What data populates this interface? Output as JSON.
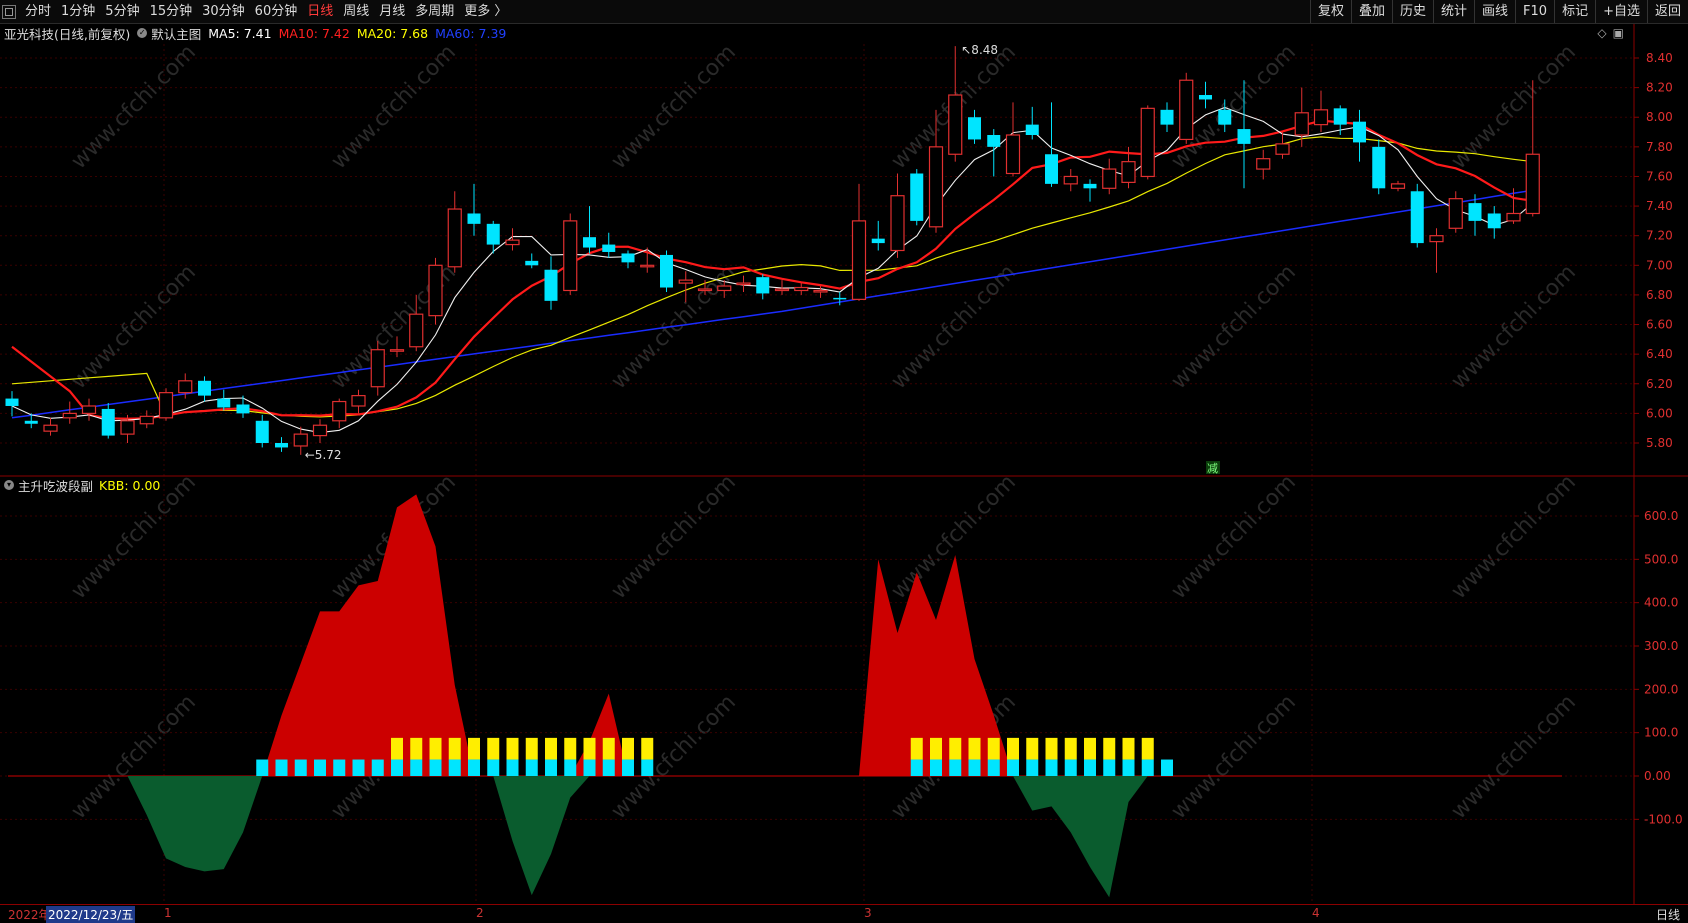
{
  "toolbar": {
    "left_items": [
      "分时",
      "1分钟",
      "5分钟",
      "15分钟",
      "30分钟",
      "60分钟",
      "日线",
      "周线",
      "月线",
      "多周期",
      "更多 〉"
    ],
    "active_item": "日线",
    "right_items": [
      "复权",
      "叠加",
      "历史",
      "统计",
      "画线",
      "F10",
      "标记",
      "+自选",
      "返回"
    ]
  },
  "main_chart": {
    "title": "亚光科技(日线,前复权)",
    "template": "默认主图",
    "ma": [
      {
        "label": "MA5: 7.41",
        "color": "#ffffff"
      },
      {
        "label": "MA10: 7.42",
        "color": "#ff2020"
      },
      {
        "label": "MA20: 7.68",
        "color": "#ffff00"
      },
      {
        "label": "MA60: 7.39",
        "color": "#2040ff"
      }
    ],
    "y_ticks": [
      "8.40",
      "8.20",
      "8.00",
      "7.80",
      "7.60",
      "7.40",
      "7.20",
      "7.00",
      "6.80",
      "6.60",
      "6.40",
      "6.20",
      "6.00",
      "5.80"
    ],
    "high_label": "8.48",
    "low_label": "5.72",
    "marker_text": "减",
    "candles": [
      [
        6.1,
        6.05,
        6.15,
        5.98
      ],
      [
        5.95,
        5.93,
        6.0,
        5.9
      ],
      [
        5.88,
        5.92,
        5.97,
        5.85
      ],
      [
        5.97,
        6.0,
        6.08,
        5.93
      ],
      [
        6.0,
        6.05,
        6.1,
        5.95
      ],
      [
        6.03,
        5.85,
        6.07,
        5.83
      ],
      [
        5.86,
        5.95,
        5.99,
        5.8
      ],
      [
        5.93,
        5.98,
        6.02,
        5.9
      ],
      [
        5.97,
        6.14,
        6.17,
        5.95
      ],
      [
        6.14,
        6.22,
        6.27,
        6.1
      ],
      [
        6.22,
        6.12,
        6.25,
        6.08
      ],
      [
        6.1,
        6.04,
        6.16,
        6.02
      ],
      [
        6.06,
        6.0,
        6.12,
        5.97
      ],
      [
        5.95,
        5.8,
        5.99,
        5.77
      ],
      [
        5.8,
        5.77,
        5.84,
        5.74
      ],
      [
        5.78,
        5.86,
        5.91,
        5.72
      ],
      [
        5.85,
        5.92,
        5.96,
        5.8
      ],
      [
        5.95,
        6.08,
        6.1,
        5.9
      ],
      [
        6.05,
        6.12,
        6.16,
        6.0
      ],
      [
        6.18,
        6.43,
        6.49,
        6.12
      ],
      [
        6.43,
        6.43,
        6.52,
        6.38
      ],
      [
        6.45,
        6.67,
        6.8,
        6.42
      ],
      [
        6.66,
        7.0,
        7.05,
        6.6
      ],
      [
        6.99,
        7.38,
        7.5,
        6.95
      ],
      [
        7.35,
        7.28,
        7.55,
        7.2
      ],
      [
        7.28,
        7.14,
        7.3,
        7.08
      ],
      [
        7.14,
        7.17,
        7.25,
        7.1
      ],
      [
        7.03,
        7.0,
        7.08,
        6.98
      ],
      [
        6.97,
        6.76,
        7.06,
        6.7
      ],
      [
        6.83,
        7.3,
        7.35,
        6.8
      ],
      [
        7.19,
        7.12,
        7.4,
        7.08
      ],
      [
        7.14,
        7.09,
        7.22,
        7.05
      ],
      [
        7.08,
        7.02,
        7.1,
        6.98
      ],
      [
        7.0,
        7.0,
        7.12,
        6.95
      ],
      [
        7.07,
        6.85,
        7.1,
        6.82
      ],
      [
        6.88,
        6.9,
        6.96,
        6.75
      ],
      [
        6.84,
        6.84,
        6.9,
        6.8
      ],
      [
        6.83,
        6.86,
        6.9,
        6.78
      ],
      [
        6.87,
        6.88,
        6.93,
        6.82
      ],
      [
        6.92,
        6.81,
        6.94,
        6.77
      ],
      [
        6.84,
        6.84,
        6.9,
        6.8
      ],
      [
        6.83,
        6.85,
        6.88,
        6.8
      ],
      [
        6.83,
        6.83,
        6.86,
        6.78
      ],
      [
        6.78,
        6.77,
        6.82,
        6.73
      ],
      [
        6.77,
        7.3,
        7.55,
        6.76
      ],
      [
        7.18,
        7.15,
        7.3,
        7.1
      ],
      [
        7.1,
        7.47,
        7.62,
        7.05
      ],
      [
        7.62,
        7.3,
        7.65,
        7.27
      ],
      [
        7.26,
        7.8,
        8.05,
        7.22
      ],
      [
        7.75,
        8.15,
        8.48,
        7.7
      ],
      [
        8.0,
        7.85,
        8.05,
        7.82
      ],
      [
        7.88,
        7.8,
        7.92,
        7.6
      ],
      [
        7.62,
        7.88,
        8.1,
        7.6
      ],
      [
        7.95,
        7.88,
        8.07,
        7.85
      ],
      [
        7.75,
        7.55,
        8.1,
        7.53
      ],
      [
        7.55,
        7.6,
        7.65,
        7.5
      ],
      [
        7.55,
        7.52,
        7.58,
        7.43
      ],
      [
        7.52,
        7.65,
        7.72,
        7.48
      ],
      [
        7.56,
        7.7,
        7.8,
        7.52
      ],
      [
        7.6,
        8.06,
        8.08,
        7.58
      ],
      [
        8.05,
        7.95,
        8.1,
        7.9
      ],
      [
        7.85,
        8.25,
        8.3,
        7.82
      ],
      [
        8.15,
        8.12,
        8.24,
        8.06
      ],
      [
        8.05,
        7.95,
        8.12,
        7.9
      ],
      [
        7.92,
        7.82,
        8.25,
        7.52
      ],
      [
        7.65,
        7.72,
        7.78,
        7.58
      ],
      [
        7.75,
        7.82,
        7.9,
        7.72
      ],
      [
        7.88,
        8.03,
        8.2,
        7.8
      ],
      [
        7.95,
        8.05,
        8.18,
        7.9
      ],
      [
        8.06,
        7.95,
        8.08,
        7.88
      ],
      [
        7.97,
        7.83,
        8.05,
        7.7
      ],
      [
        7.8,
        7.52,
        7.85,
        7.48
      ],
      [
        7.52,
        7.55,
        7.57,
        7.5
      ],
      [
        7.5,
        7.15,
        7.55,
        7.12
      ],
      [
        7.16,
        7.2,
        7.25,
        6.95
      ],
      [
        7.25,
        7.45,
        7.5,
        7.22
      ],
      [
        7.42,
        7.3,
        7.48,
        7.2
      ],
      [
        7.35,
        7.25,
        7.4,
        7.18
      ],
      [
        7.3,
        7.35,
        7.52,
        7.28
      ],
      [
        7.35,
        7.75,
        8.25,
        7.33
      ]
    ]
  },
  "indicator": {
    "name": "主升吃波段副",
    "value_label": "KBB: 0.00",
    "y_ticks": [
      "600.0",
      "500.0",
      "400.0",
      "300.0",
      "200.0",
      "100.0",
      "0.00",
      "-100.0"
    ],
    "area": [
      0,
      0,
      0,
      0,
      0,
      0,
      0,
      -90,
      -190,
      -210,
      -220,
      -215,
      -130,
      0,
      140,
      260,
      380,
      380,
      440,
      450,
      620,
      650,
      530,
      210,
      0,
      0,
      -150,
      -275,
      -180,
      -50,
      80,
      190,
      0,
      0,
      0,
      0,
      0,
      0,
      0,
      0,
      0,
      0,
      0,
      0,
      0,
      500,
      330,
      470,
      360,
      510,
      270,
      140,
      0,
      -80,
      -70,
      -130,
      -210,
      -280,
      -60,
      0,
      0,
      0,
      0,
      0,
      0,
      0,
      0,
      0,
      0,
      0,
      0,
      0,
      0,
      0,
      0,
      0,
      0,
      0,
      0,
      0
    ],
    "cyan_bars": [
      0,
      0,
      0,
      0,
      0,
      0,
      0,
      0,
      0,
      0,
      0,
      0,
      0,
      1,
      1,
      1,
      1,
      1,
      1,
      1,
      1,
      1,
      1,
      1,
      1,
      1,
      1,
      1,
      1,
      1,
      1,
      1,
      1,
      1,
      0,
      0,
      0,
      0,
      0,
      0,
      0,
      0,
      0,
      0,
      0,
      0,
      0,
      1,
      1,
      1,
      1,
      1,
      1,
      1,
      1,
      1,
      1,
      1,
      1,
      1,
      1,
      0,
      0,
      0,
      0,
      0,
      0,
      0,
      0,
      0,
      0,
      0,
      0,
      0,
      0,
      0,
      0,
      0,
      0,
      0
    ],
    "yellow_bars": [
      0,
      0,
      0,
      0,
      0,
      0,
      0,
      0,
      0,
      0,
      0,
      0,
      0,
      0,
      0,
      0,
      0,
      0,
      0,
      0,
      1,
      1,
      1,
      1,
      1,
      1,
      1,
      1,
      1,
      1,
      1,
      1,
      1,
      1,
      0,
      0,
      0,
      0,
      0,
      0,
      0,
      0,
      0,
      0,
      0,
      0,
      0,
      1,
      1,
      1,
      1,
      1,
      1,
      1,
      1,
      1,
      1,
      1,
      1,
      1,
      0,
      0,
      0,
      0,
      0,
      0,
      0,
      0,
      0,
      0,
      0,
      0,
      0,
      0,
      0,
      0,
      0,
      0,
      0,
      0
    ]
  },
  "bottom": {
    "date_prefix": "2022年",
    "selected_date": "2022/12/23/五",
    "month_ticks": [
      "1",
      "2",
      "3",
      "4"
    ],
    "period": "日线"
  },
  "watermark": "www.cfchi.com",
  "colors": {
    "up": "#e03030",
    "down": "#00e5ff",
    "grid": "#3a0000",
    "axis": "#8b0000",
    "area_pos": "#cc0000",
    "area_neg": "#0a5c2e"
  }
}
